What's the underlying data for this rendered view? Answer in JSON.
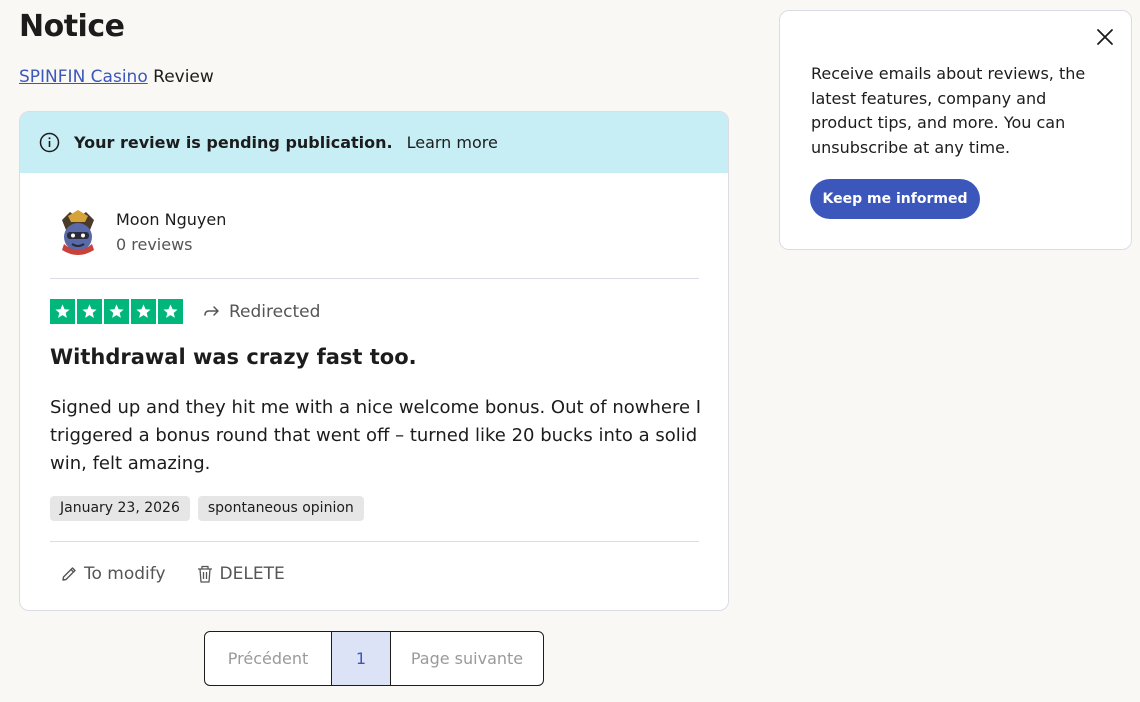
{
  "page": {
    "title": "Notice",
    "company_link": "SPINFIN Casino",
    "subtitle_suffix": "Review"
  },
  "notice": {
    "pending_text": "Your review is pending publication.",
    "learn_more": "Learn more"
  },
  "review": {
    "author": "Moon Nguyen",
    "author_reviews": "0 reviews",
    "rating": 5,
    "rating_max": 5,
    "source_label": "Redirected",
    "title": "Withdrawal was crazy fast too.",
    "body": "Signed up and they hit me with a nice welcome bonus. Out of nowhere I triggered a bonus round that went off – turned like 20 bucks into a solid win, felt amazing.",
    "tags": [
      "January 23, 2026",
      "spontaneous opinion"
    ],
    "actions": {
      "modify": "To modify",
      "delete": "DELETE"
    }
  },
  "pagination": {
    "prev": "Précédent",
    "current": "1",
    "next": "Page suivante"
  },
  "newsletter": {
    "text": "Receive emails about reviews, the latest features, company and product tips, and more. You can unsubscribe at any time.",
    "button": "Keep me informed"
  },
  "colors": {
    "accent": "#3c57bc",
    "star_green": "#00b67a",
    "notice_bg": "#c6eef4"
  }
}
